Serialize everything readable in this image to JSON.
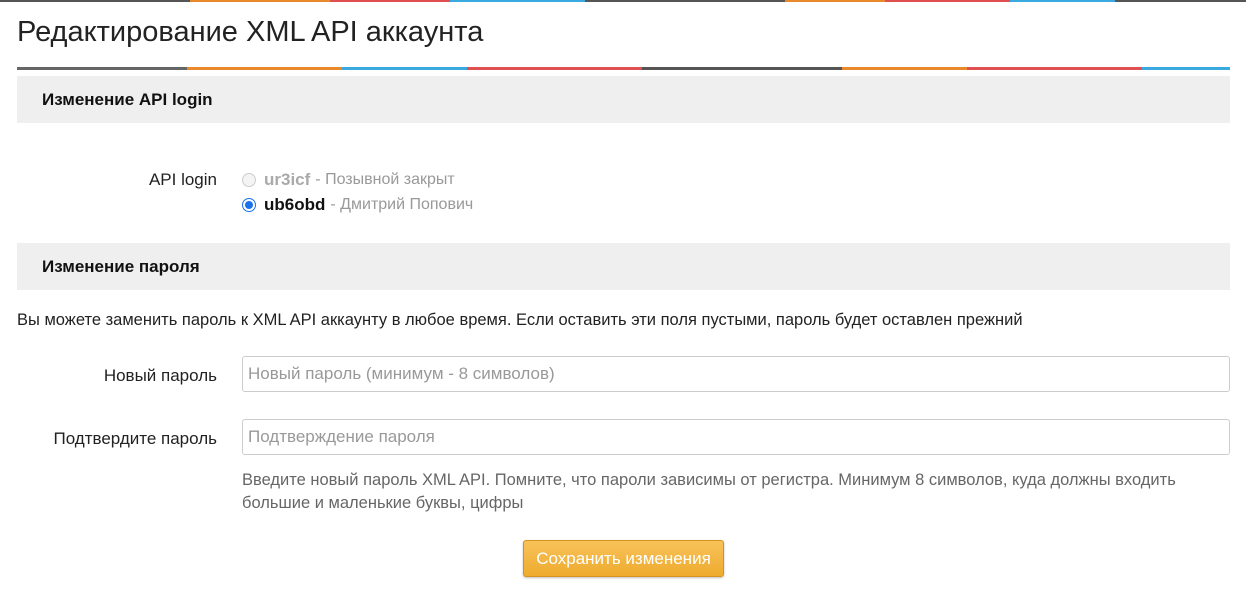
{
  "page": {
    "title": "Редактирование XML API аккаунта"
  },
  "login_section": {
    "header": "Изменение API login",
    "label": "API login",
    "options": [
      {
        "login": "ur3icf",
        "description": "- Позывной закрыт",
        "selected": false,
        "disabled": true
      },
      {
        "login": "ub6obd",
        "description": "- Дмитрий Попович",
        "selected": true,
        "disabled": false
      }
    ]
  },
  "password_section": {
    "header": "Изменение пароля",
    "intro": "Вы можете заменить пароль к XML API аккаунту в любое время. Если оставить эти поля пустыми, пароль будет оставлен прежний",
    "new_password": {
      "label": "Новый пароль",
      "value": "",
      "placeholder": "Новый пароль (минимум - 8 символов)"
    },
    "confirm_password": {
      "label": "Подтвердите пароль",
      "value": "",
      "placeholder": "Подтверждение пароля"
    },
    "hint": "Введите новый пароль XML API. Помните, что пароли зависимы от регистра. Минимум 8 символов, куда должны входить большие и маленькие буквы, цифры"
  },
  "actions": {
    "save_label": "Сохранить изменения"
  },
  "colors": {
    "accent_orange": "#eeab2e",
    "radio_blue": "#1a73e8",
    "section_bg": "#efefef"
  }
}
